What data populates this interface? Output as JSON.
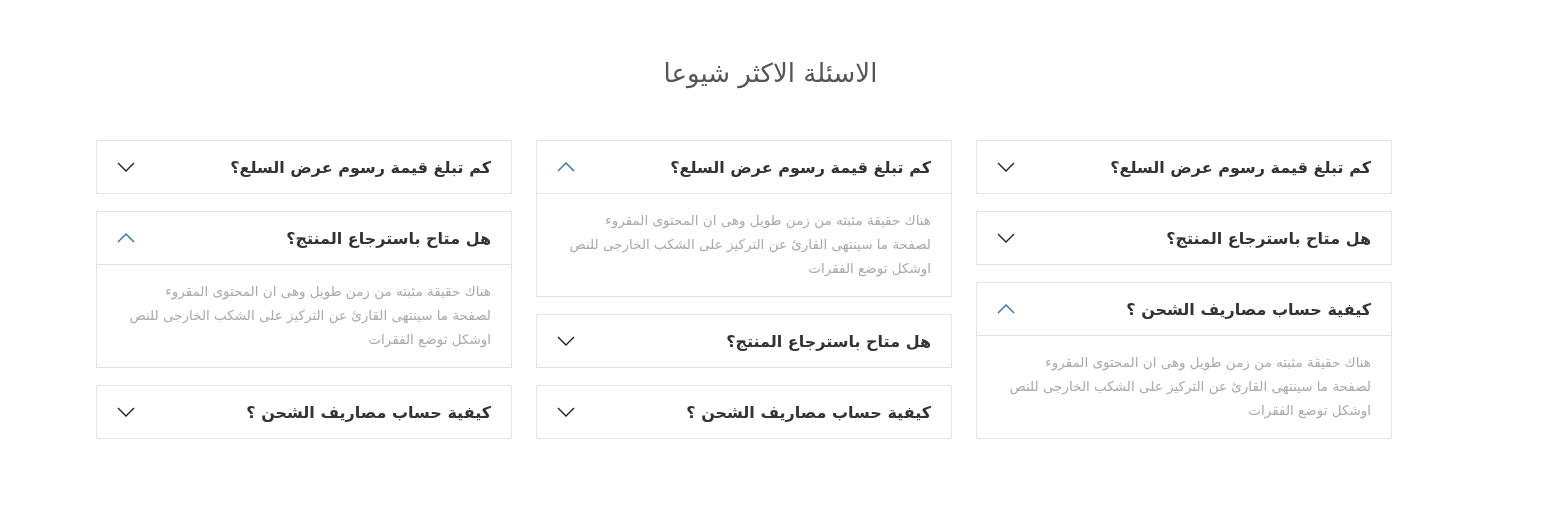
{
  "title": "الاسئلة الاكثر شيوعا",
  "columns": [
    {
      "items": [
        {
          "question": "كم تبلغ قيمة رسوم عرض السلع؟",
          "expanded": false
        },
        {
          "question": "هل متاح باسترجاع المنتج؟",
          "expanded": false
        },
        {
          "question": "كيفية حساب مصاريف الشحن ؟",
          "expanded": true,
          "answer": "هناك حقيقة مثبته من زمن طويل وهى ان المحتوى المقروء لصفحة ما سينتهى القارئ عن التركيز على الشكب الخارجى للنص اوشكل توضع الفقرات"
        }
      ]
    },
    {
      "items": [
        {
          "question": "كم تبلغ قيمة رسوم عرض السلع؟",
          "expanded": true,
          "answer": "هناك حقيقة مثبته من زمن طويل وهى ان المحتوى المقروء لصفحة ما سينتهى القارئ عن التركيز على الشكب الخارجى للنص اوشكل توضع الفقرات"
        },
        {
          "question": "هل متاح باسترجاع المنتج؟",
          "expanded": false
        },
        {
          "question": "كيفية حساب مصاريف الشحن ؟",
          "expanded": false
        }
      ]
    },
    {
      "items": [
        {
          "question": "كم تبلغ قيمة رسوم عرض السلع؟",
          "expanded": false
        },
        {
          "question": "هل متاح باسترجاع المنتج؟",
          "expanded": true,
          "answer": "هناك حقيقة مثبته من زمن طويل وهى ان المحتوى المقروء لصفحة ما سينتهى القارئ عن التركيز على الشكب الخارجى للنص اوشكل توضع الفقرات"
        },
        {
          "question": "كيفية حساب مصاريف الشحن ؟",
          "expanded": false
        }
      ]
    }
  ]
}
